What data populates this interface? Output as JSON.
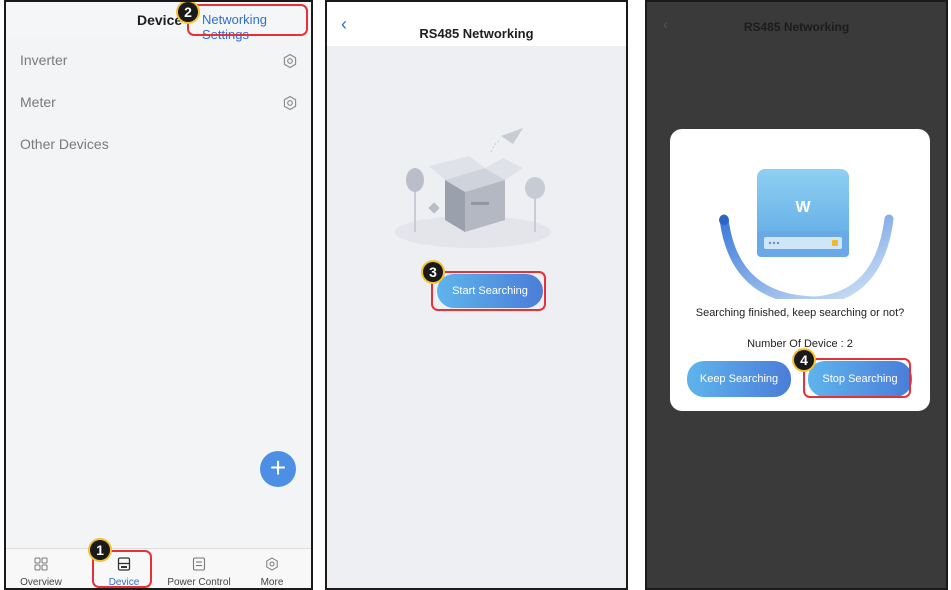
{
  "panel1": {
    "header_title": "Device",
    "networking_link": "Networking Settings",
    "devices": [
      {
        "label": "Inverter"
      },
      {
        "label": "Meter"
      },
      {
        "label": "Other Devices"
      }
    ],
    "fab_label": "+",
    "tabs": [
      {
        "label": "Overview",
        "icon": "grid-icon"
      },
      {
        "label": "Device",
        "icon": "device-icon"
      },
      {
        "label": "Power Control",
        "icon": "power-control-icon"
      },
      {
        "label": "More",
        "icon": "gear-icon"
      }
    ],
    "step_badges": [
      "1",
      "2"
    ]
  },
  "panel2": {
    "back_icon": "‹",
    "title": "RS485 Networking",
    "start_button": "Start Searching",
    "step_badge": "3"
  },
  "panel3": {
    "back_icon": "‹",
    "title": "RS485 Networking",
    "device_logo": "W",
    "message": "Searching finished, keep searching or not?",
    "device_count": "Number Of Device : 2",
    "keep_button": "Keep Searching",
    "stop_button": "Stop Searching",
    "step_badge": "4"
  },
  "colors": {
    "accent": "#2f6fd0",
    "highlight": "#e53238",
    "button_gradient_start": "#5fb4ec",
    "button_gradient_end": "#4a7dd8",
    "badge": "#1a1a1a"
  }
}
